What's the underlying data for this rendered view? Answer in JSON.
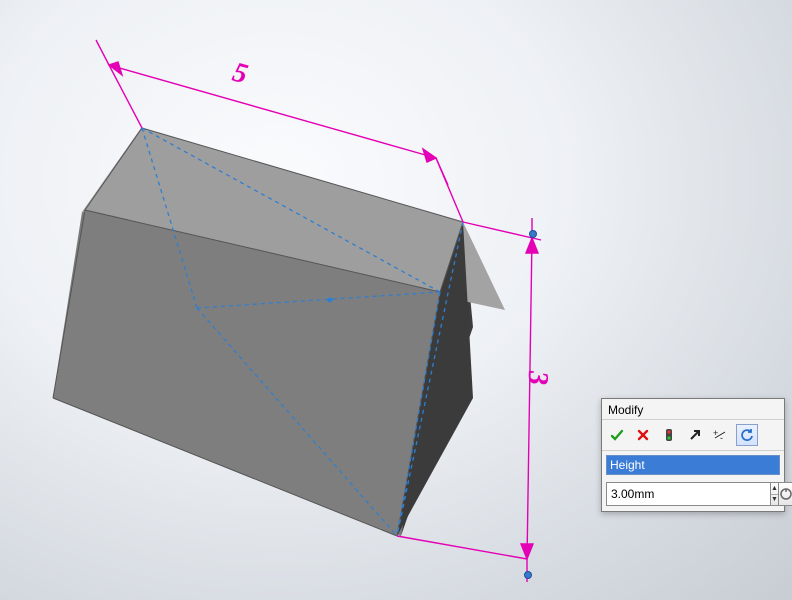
{
  "dimensions": {
    "length_label": "5",
    "height_label": "3"
  },
  "modify_dialog": {
    "title": "Modify",
    "name_value": "Height",
    "value": "3.00mm",
    "icons": {
      "ok": "ok-icon",
      "cancel": "cancel-icon",
      "rebuild": "rebuild-icon",
      "reverse": "reverse-icon",
      "reset": "reset-icon",
      "mark": "mark-icon"
    }
  }
}
